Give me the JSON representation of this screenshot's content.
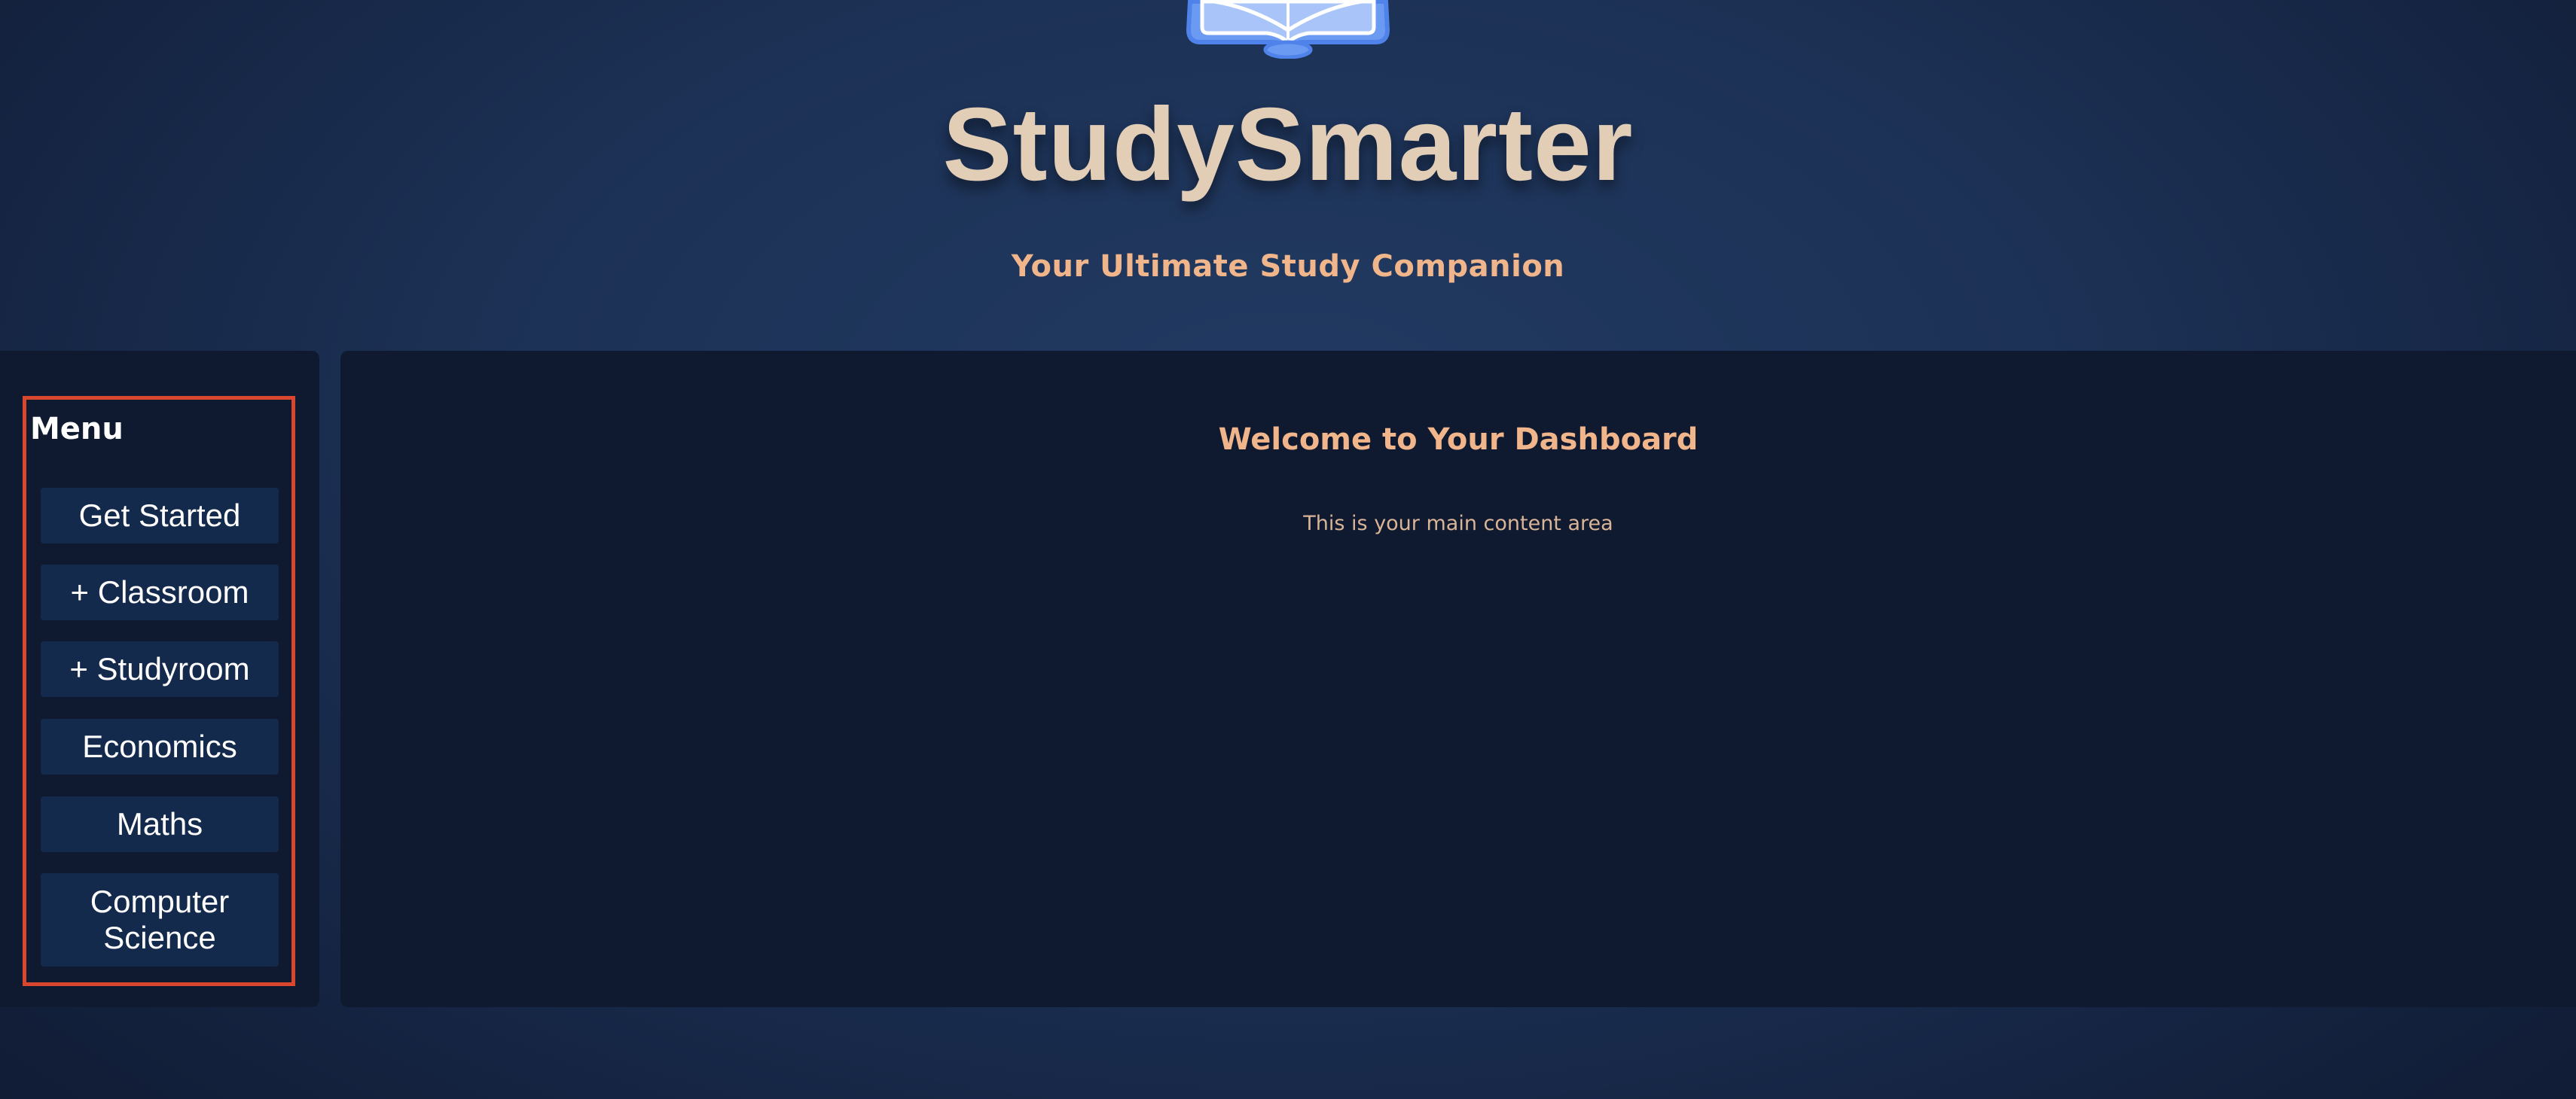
{
  "header": {
    "logo_icon": "open-book-icon",
    "title": "StudySmarter",
    "subtitle": "Your Ultimate Study Companion"
  },
  "sidebar": {
    "title": "Menu",
    "items": [
      {
        "label": "Get Started"
      },
      {
        "label": "+ Classroom"
      },
      {
        "label": "+ Studyroom"
      },
      {
        "label": "Economics"
      },
      {
        "label": "Maths"
      },
      {
        "label": "Computer Science"
      }
    ]
  },
  "main": {
    "title": "Welcome to Your Dashboard",
    "text": "This is your main content area"
  },
  "colors": {
    "background": "#1c3155",
    "panel": "#0f1a30",
    "button": "#142a4d",
    "title": "#e2cdb6",
    "accent": "#f0b58a",
    "highlight_border": "#d9472e",
    "logo_blue": "#5b8def"
  }
}
